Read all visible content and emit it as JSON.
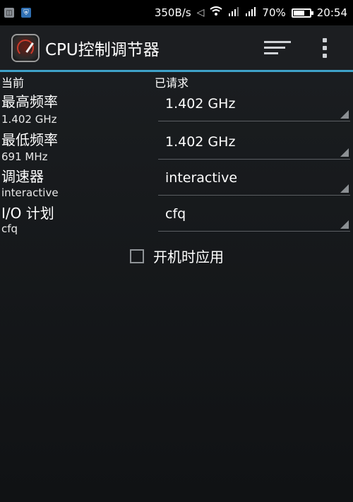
{
  "status_bar": {
    "net_speed": "350B/s",
    "battery_percent": "70%",
    "battery_level": 0.7,
    "time": "20:54",
    "icons": [
      "app-badge-icon",
      "shield-icon",
      "mute-icon",
      "wifi-icon",
      "signal-icon",
      "signal-icon",
      "battery-icon"
    ]
  },
  "action_bar": {
    "title": "CPU控制调节器",
    "accent_color": "#3ea2c9",
    "actions": [
      "sort-icon",
      "overflow-menu-icon"
    ]
  },
  "headers": {
    "current": "当前",
    "requested": "已请求"
  },
  "rows": [
    {
      "label": "最高频率",
      "current": "1.402 GHz",
      "requested": "1.402 GHz"
    },
    {
      "label": "最低频率",
      "current": "691 MHz",
      "requested": "1.402 GHz"
    },
    {
      "label": "调速器",
      "current": "interactive",
      "requested": "interactive"
    },
    {
      "label": "I/O 计划",
      "current": "cfq",
      "requested": "cfq"
    }
  ],
  "apply_on_boot": {
    "label": "开机时应用",
    "checked": false
  }
}
